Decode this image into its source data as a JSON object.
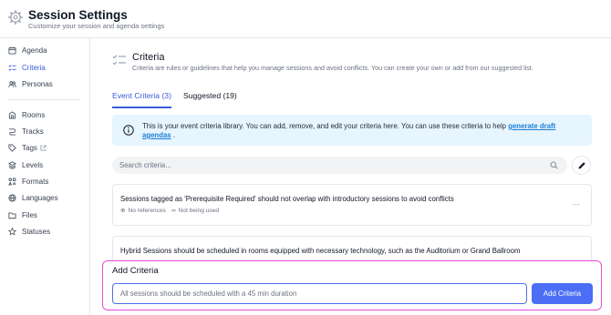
{
  "header": {
    "title": "Session Settings",
    "subtitle": "Customize your session and agenda settings"
  },
  "sidebar": {
    "items": [
      {
        "label": "Agenda",
        "icon": "calendar-icon"
      },
      {
        "label": "Criteria",
        "icon": "criteria-list-icon",
        "active": true
      },
      {
        "label": "Personas",
        "icon": "users-icon"
      },
      {
        "label": "Rooms",
        "icon": "door-icon"
      },
      {
        "label": "Tracks",
        "icon": "track-icon"
      },
      {
        "label": "Tags",
        "icon": "tag-icon",
        "external": true
      },
      {
        "label": "Levels",
        "icon": "layers-icon"
      },
      {
        "label": "Formats",
        "icon": "formats-icon"
      },
      {
        "label": "Languages",
        "icon": "globe-icon"
      },
      {
        "label": "Files",
        "icon": "folder-icon"
      },
      {
        "label": "Statuses",
        "icon": "star-icon"
      }
    ]
  },
  "main": {
    "title": "Criteria",
    "description": "Criteria are rules or guidelines that help you manage sessions and avoid conflicts. You can create your own or add from our suggested list.",
    "tabs": [
      {
        "label": "Event Criteria (3)",
        "active": true
      },
      {
        "label": "Suggested (19)",
        "active": false
      }
    ],
    "info": {
      "text": "This is your event criteria library. You can add, remove, and edit your criteria here. You can use these criteria to help",
      "link": "generate draft agendas",
      "suffix": "."
    },
    "search": {
      "placeholder": "Search criteria..."
    },
    "criteria": [
      {
        "title": "Sessions tagged as 'Prerequisite Required' should not overlap with introductory sessions to avoid conflicts",
        "references": "No references",
        "usage": "Not being used"
      },
      {
        "title": "Hybrid Sessions should be scheduled in rooms equipped with necessary technology, such as the Auditorium or Grand Ballroom"
      }
    ]
  },
  "add_panel": {
    "title": "Add Criteria",
    "input_value": "",
    "placeholder": "All sessions should be scheduled with a 45 min duration",
    "button_label": "Add Criteria"
  },
  "colors": {
    "accent": "#4c6ef5",
    "active_nav": "#3b5bdb",
    "info_bg": "#e7f5ff",
    "highlight_border": "#e64bd6"
  }
}
